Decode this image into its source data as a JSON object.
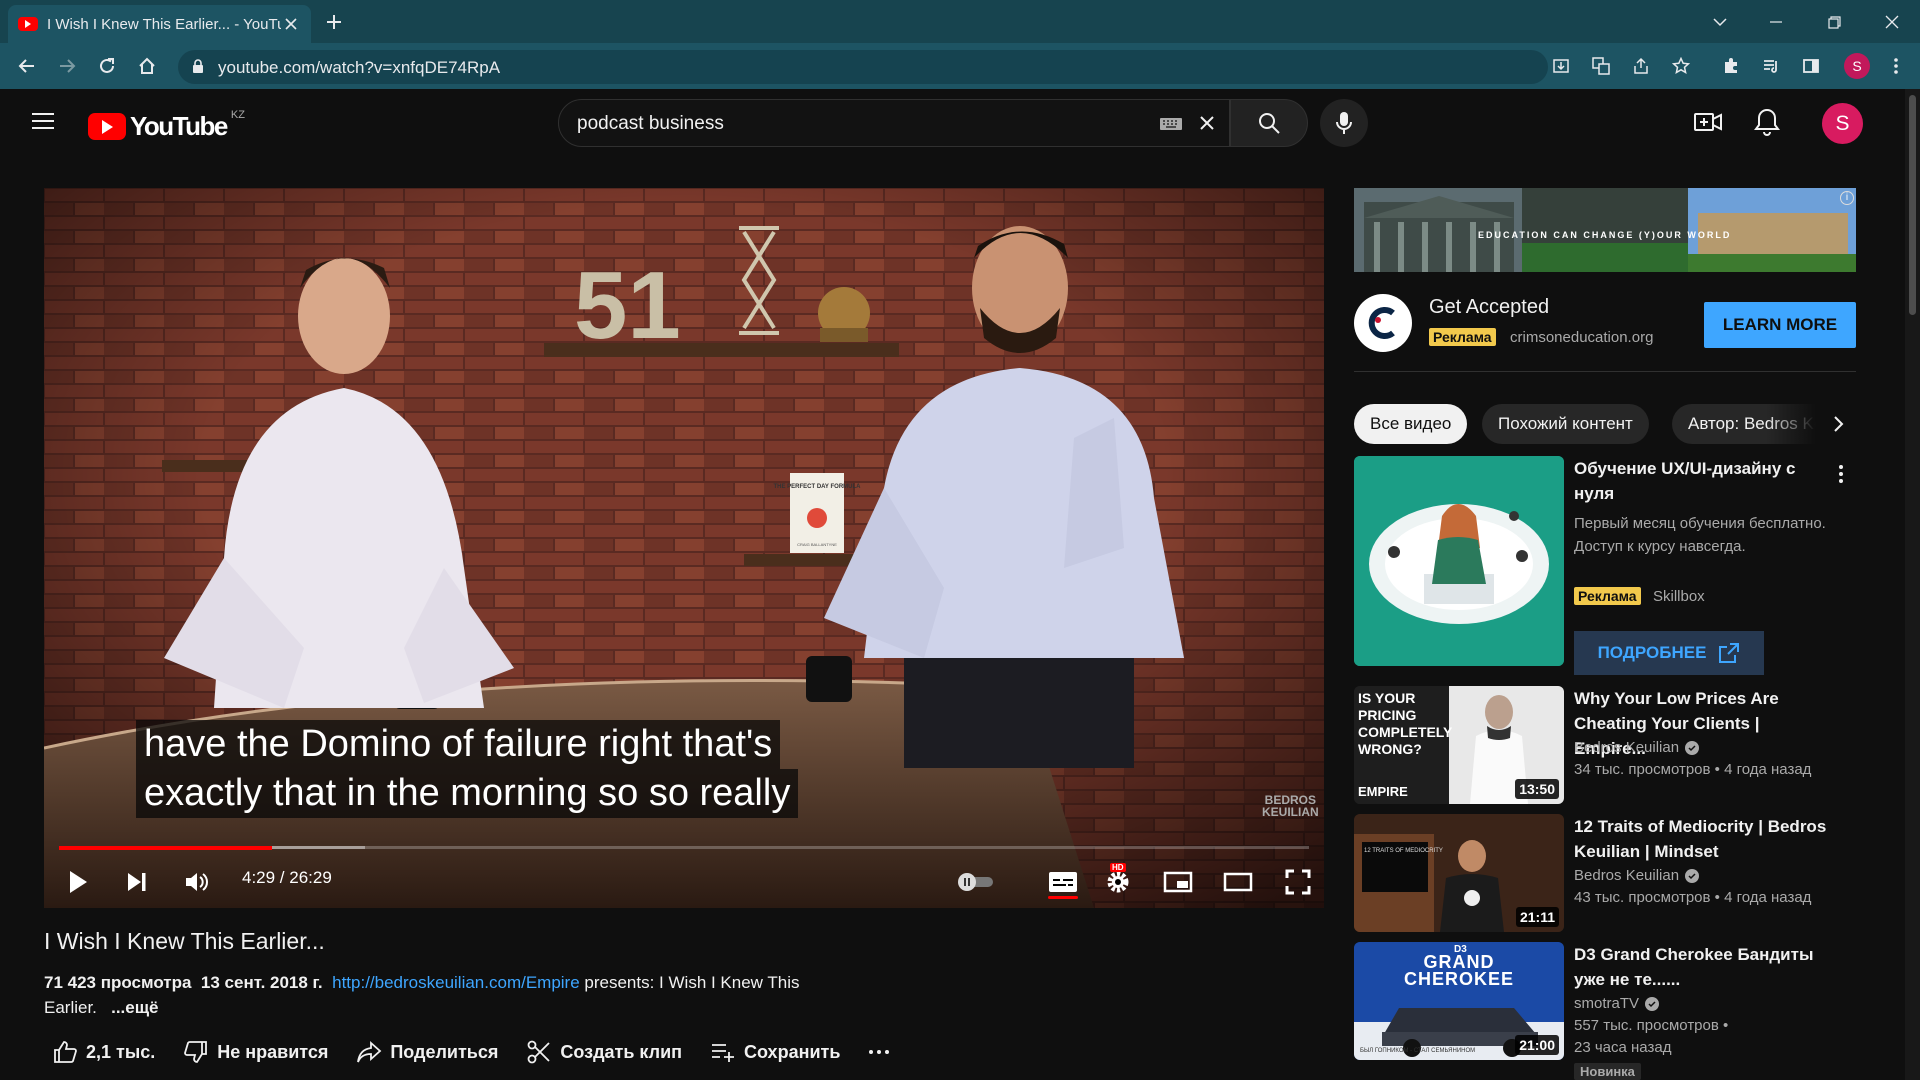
{
  "browser": {
    "tab_title": "I Wish I Knew This Earlier... - YouTube",
    "url": "youtube.com/watch?v=xnfqDE74RpA",
    "profile_initial": "S"
  },
  "header": {
    "logo_text": "YouTube",
    "country_code": "KZ",
    "search_query": "podcast business",
    "avatar_initial": "S"
  },
  "player": {
    "caption_lines": [
      "have the Domino of failure right that's",
      "exactly that in the morning so so really"
    ],
    "watermark": "BEDROS KEUILIAN",
    "time": "4:29 / 26:29",
    "progress": 0.17,
    "buffered": 0.245,
    "hd_label": "HD",
    "scene": {
      "sign": "51",
      "book_title": "THE PERFECT DAY FORMULA",
      "book_author": "CRAIG BALLANTYNE"
    }
  },
  "video": {
    "title": "I Wish I Knew This Earlier...",
    "views": "71 423 просмотра",
    "date": "13 сент. 2018 г.",
    "link": "http://bedroskeuilian.com/Empire",
    "desc_text": " presents: I Wish I Knew This Earlier.",
    "more": "...ещё",
    "actions": {
      "likes": "2,1 тыс.",
      "dislike": "Не нравится",
      "share": "Поделиться",
      "clip": "Создать клип",
      "save": "Сохранить"
    }
  },
  "ad": {
    "banner_text": "EDUCATION CAN CHANGE (Y)OUR WORLD",
    "info": "i",
    "title": "Get Accepted",
    "badge": "Реклама",
    "domain": "crimsoneducation.org",
    "cta": "LEARN MORE"
  },
  "chips": [
    "Все видео",
    "Похожий контент",
    "Автор: Bedros Keuilian"
  ],
  "ad2": {
    "title": "Обучение UX/UI-дизайну с нуля",
    "description": "Первый месяц обучения бесплатно. Доступ к курсу навсегда.",
    "badge": "Реклама",
    "advertiser": "Skillbox",
    "cta": "ПОДРОБНЕЕ"
  },
  "recommendations": [
    {
      "title": "Why Your Low Prices Are Cheating Your Clients | Empire...",
      "channel": "Bedros Keuilian",
      "meta": "34 тыс. просмотров • 4 года назад",
      "duration": "13:50",
      "thumb_text": "IS YOUR PRICING COMPLETELY WRONG?",
      "thumb_brand": "EMPIRE"
    },
    {
      "title": "12 Traits of Mediocrity | Bedros Keuilian | Mindset",
      "channel": "Bedros Keuilian",
      "meta": "43 тыс. просмотров • 4 года назад",
      "duration": "21:11",
      "thumb_text": "12 TRAITS OF MEDIOCRITY"
    },
    {
      "title": "D3 Grand Cherokee Бандиты уже не те......",
      "channel": "smotraTV",
      "meta": "557 тыс. просмотров • 23 часа назад",
      "duration": "21:00",
      "thumb_text": "GRAND CHEROKEE",
      "thumb_brand": "D3",
      "thumb_caption": "БЫЛ ГОПНИКОМ - СТАЛ СЕМЬЯНИНОМ",
      "badge": "Новинка"
    }
  ]
}
